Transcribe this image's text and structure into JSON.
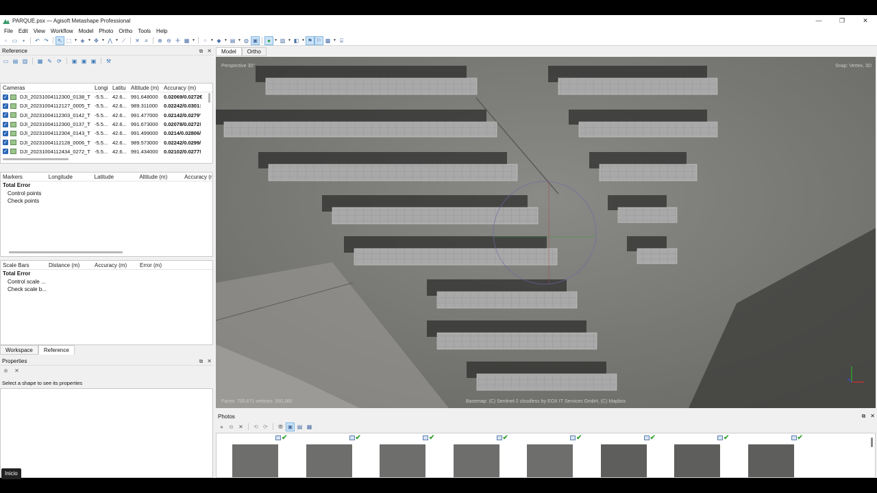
{
  "window": {
    "title": "PARQUE.psx — Agisoft Metashape Professional",
    "controls": [
      "—",
      "❐",
      "✕"
    ]
  },
  "menu": [
    "File",
    "Edit",
    "View",
    "Workflow",
    "Model",
    "Photo",
    "Ortho",
    "Tools",
    "Help"
  ],
  "reference_panel": {
    "title": "Reference",
    "cameras_table": {
      "columns": [
        "Cameras",
        "Longi",
        "Latitu",
        "Altitude (m)",
        "Accuracy (m)"
      ],
      "rows": [
        {
          "name": "DJI_20231004112300_0138_T",
          "lon": "-5.5...",
          "lat": "42.6...",
          "alt": "991.648000",
          "acc": "0.02069/0.0272€"
        },
        {
          "name": "DJI_20231004112127_0005_T",
          "lon": "-5.5...",
          "lat": "42.6...",
          "alt": "989.311000",
          "acc": "0.02242/0.0301:"
        },
        {
          "name": "DJI_20231004112303_0142_T",
          "lon": "-5.5...",
          "lat": "42.6...",
          "alt": "991.477000",
          "acc": "0.02142/0.0279'"
        },
        {
          "name": "DJI_20231004112300_0137_T",
          "lon": "-5.5...",
          "lat": "42.6...",
          "alt": "991.673000",
          "acc": "0.02078/0.0272!"
        },
        {
          "name": "DJI_20231004112304_0143_T",
          "lon": "-5.5...",
          "lat": "42.6...",
          "alt": "991.499000",
          "acc": "0.0214/0.02806/"
        },
        {
          "name": "DJI_20231004112128_0006_T",
          "lon": "-5.5...",
          "lat": "42.6...",
          "alt": "989.573000",
          "acc": "0.02242/0.0299/"
        },
        {
          "name": "DJI_20231004112434_0272_T",
          "lon": "-5.5...",
          "lat": "42.6...",
          "alt": "991.434000",
          "acc": "0.02102/0.0277!"
        }
      ]
    },
    "markers_table": {
      "columns": [
        "Markers",
        "Longitude",
        "Latitude",
        "Altitude (m)",
        "Accuracy (r"
      ],
      "rows": [
        "Total Error",
        "Control points",
        "Check points"
      ]
    },
    "scalebars_table": {
      "columns": [
        "Scale Bars",
        "Distance (m)",
        "Accuracy (m)",
        "Error (m)"
      ],
      "rows": [
        "Total Error",
        "Control scale ...",
        "Check scale b..."
      ]
    },
    "tabs": [
      "Workspace",
      "Reference"
    ]
  },
  "properties_panel": {
    "title": "Properties",
    "hint": "Select a shape to see its properties"
  },
  "view": {
    "tabs": [
      "Model",
      "Ortho"
    ],
    "perspective": "Perspective 30°",
    "snap": "Snap: Vertex, 3D",
    "faces": "Faces: 700,671 vertices: 350,360",
    "basemap": "Basemap: (C) Sentinel-2 cloudless by EOX IT Services GmbH, (C) Mapbox"
  },
  "photos_panel": {
    "title": "Photos",
    "thumb_count": 8
  },
  "taskbar": {
    "start": "Inicio"
  }
}
